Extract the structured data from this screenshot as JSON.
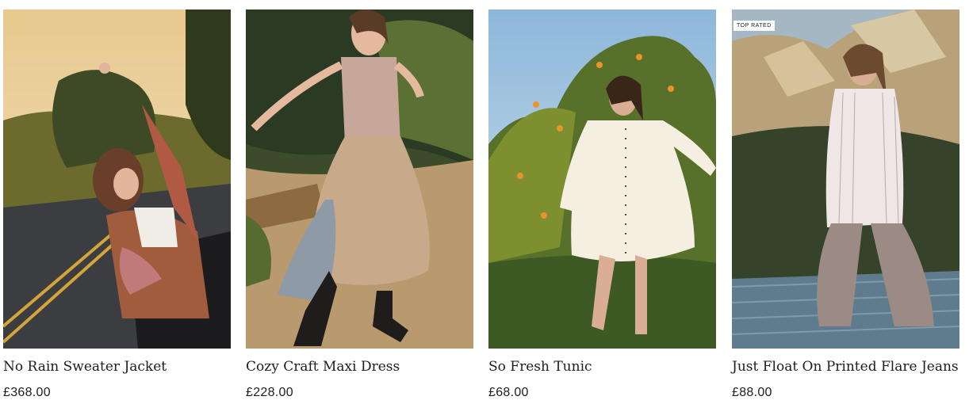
{
  "products": [
    {
      "name": "No Rain Sweater Jacket",
      "price": "£368.00",
      "badge": ""
    },
    {
      "name": "Cozy Craft Maxi Dress",
      "price": "£228.00",
      "badge": ""
    },
    {
      "name": "So Fresh Tunic",
      "price": "£68.00",
      "badge": ""
    },
    {
      "name": "Just Float On Printed Flare Jeans",
      "price": "£88.00",
      "badge": "TOP RATED"
    }
  ],
  "colors": {
    "text": "#1d1d1d",
    "background": "#ffffff"
  }
}
